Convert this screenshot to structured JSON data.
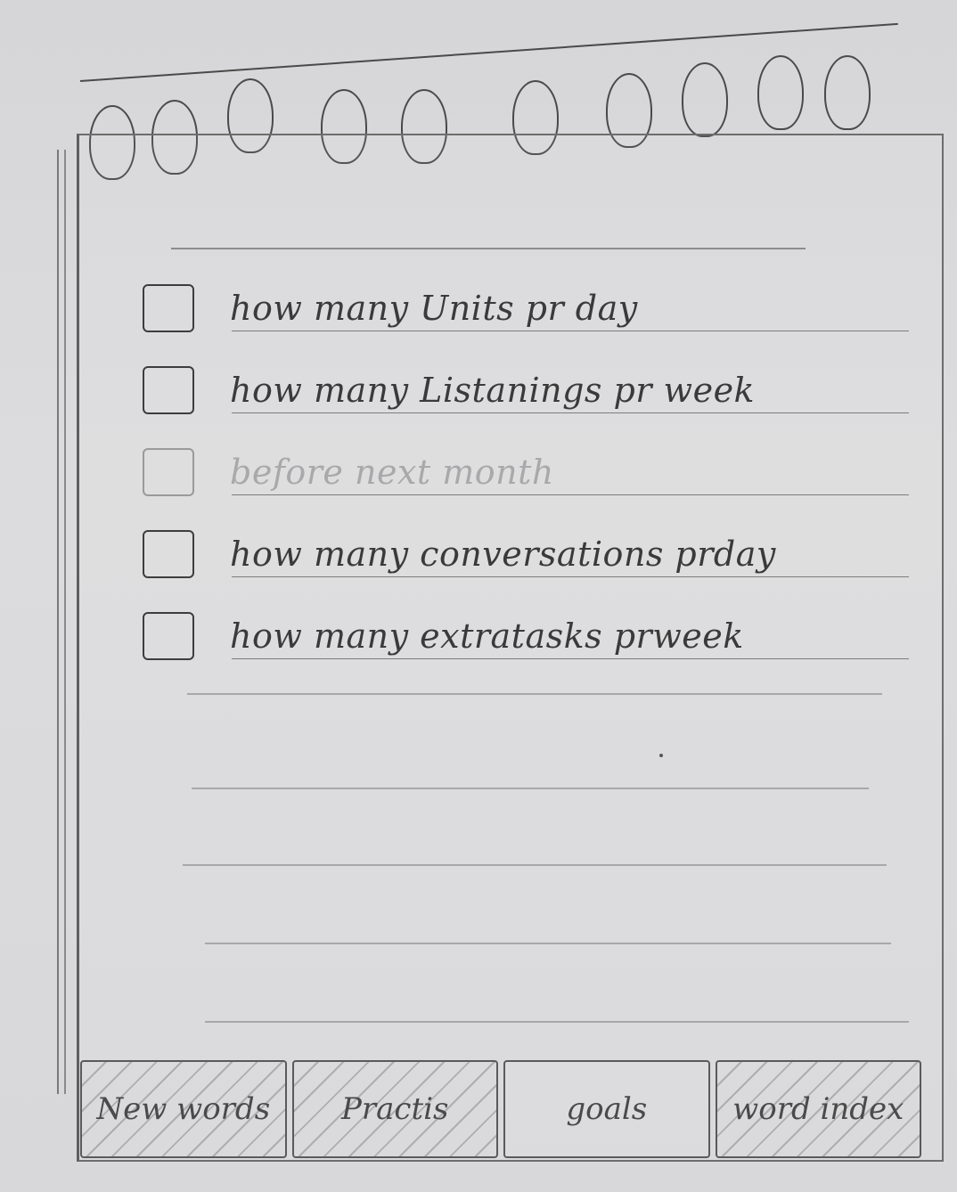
{
  "goals": {
    "items": [
      {
        "label": "how many Units pr day",
        "checked": false,
        "faded": false
      },
      {
        "label": "how many Listanings pr week",
        "checked": false,
        "faded": false
      },
      {
        "label": "before next month",
        "checked": false,
        "faded": true
      },
      {
        "label": "how many conversations prday",
        "checked": false,
        "faded": false
      },
      {
        "label": "how many extratasks prweek",
        "checked": false,
        "faded": false
      }
    ]
  },
  "tabs": [
    {
      "label": "New words",
      "active": false
    },
    {
      "label": "Practis",
      "active": false
    },
    {
      "label": "goals",
      "active": true
    },
    {
      "label": "word index",
      "active": false
    }
  ]
}
